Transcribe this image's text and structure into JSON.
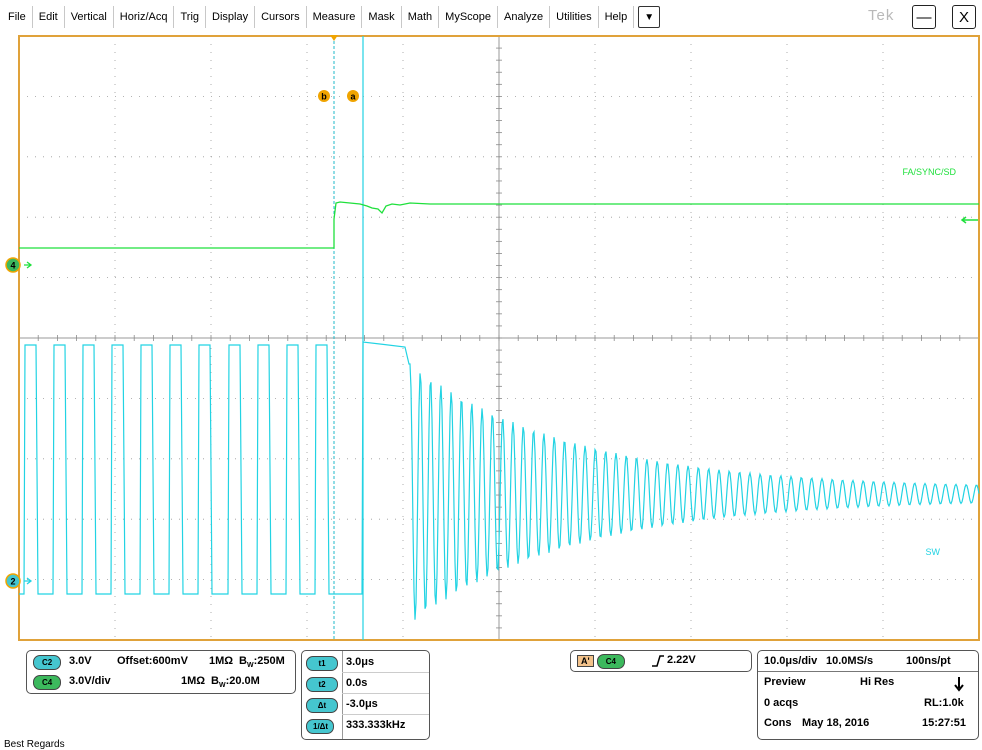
{
  "menu": [
    "File",
    "Edit",
    "Vertical",
    "Horiz/Acq",
    "Trig",
    "Display",
    "Cursors",
    "Measure",
    "Mask",
    "Math",
    "MyScope",
    "Analyze",
    "Utilities",
    "Help"
  ],
  "menu_arrow": "▼",
  "brand": "Tek",
  "window": {
    "minimize": "—",
    "close": "X"
  },
  "colors": {
    "ch4": "#1fe03c",
    "ch2": "#22d3e3",
    "grid": "#9a9a9a",
    "border": "#e0a23a",
    "marker": "#f0a400"
  },
  "cursor_labels": {
    "b": "b",
    "a": "a"
  },
  "channel_markers": {
    "ch4": "4",
    "ch2": "2"
  },
  "trace_labels": {
    "ch4": "FA/SYNC/SD",
    "ch2": "SW"
  },
  "channels": {
    "c2": {
      "badge": "C2",
      "scale": "3.0V",
      "offset": "Offset:600mV",
      "impedance": "1MΩ",
      "bw_prefix": "B",
      "bw_sub": "W",
      "bw": ":250M"
    },
    "c4": {
      "badge": "C4",
      "scale": "3.0V/div",
      "impedance": "1MΩ",
      "bw_prefix": "B",
      "bw_sub": "W",
      "bw": ":20.0M"
    }
  },
  "cursors": [
    {
      "badge": "t1",
      "value": "3.0μs"
    },
    {
      "badge": "t2",
      "value": "0.0s"
    },
    {
      "badge": "Δt",
      "value": "-3.0μs"
    },
    {
      "badge": "1/Δt",
      "value": "333.333kHz"
    }
  ],
  "trigger": {
    "mode": "A'",
    "source": "C4",
    "slope_icon": "rising-edge",
    "level": "2.22V"
  },
  "acquisition": {
    "timebase": "10.0μs/div",
    "sample_rate": "10.0MS/s",
    "resolution": "100ns/pt",
    "mode": "Preview",
    "acq_type": "Hi Res",
    "acqs": "0 acqs",
    "record_length": "RL:1.0k",
    "cons": "Cons",
    "date": "May 18, 2016",
    "time": "15:27:51"
  },
  "footer": "Best Regards"
}
